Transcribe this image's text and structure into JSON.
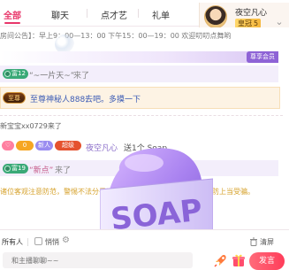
{
  "tabs": [
    {
      "label": "全部",
      "active": true
    },
    {
      "label": "聊天",
      "active": false
    },
    {
      "label": "点才艺",
      "active": false
    },
    {
      "label": "礼单",
      "active": false
    }
  ],
  "host": {
    "name": "夜空凡心",
    "level_label": "皇冠",
    "level_num": "5"
  },
  "chat": {
    "notice": "房间公告】：早上9：00—13：00 下午15：00—19：00 欢迎叨叨点舞哟",
    "vip_tag": "尊享会员",
    "enter1": {
      "level": "富12",
      "nick": "“~一片天~”",
      "msg": "来了"
    },
    "royal": {
      "badge": "至尊",
      "name": "至尊神秘人888：",
      "msg": "去吧。多摸一下"
    },
    "plain": "新宝宝xx0729来了",
    "gift": {
      "badge1": "♡",
      "badge2": "0",
      "badge3": "新人",
      "badge4": "超级",
      "name": "夜空凡心",
      "msg": "送1个 Soap"
    },
    "enter2": {
      "level": "富19",
      "nick": "“新点”",
      "msg": "来了"
    },
    "warning": "诸位客观注意防范，警惕不法分子以低价售卖等诱导性消息欺骗，谨防上当受骗。"
  },
  "sticker": {
    "text": "SOAP"
  },
  "options": {
    "target": "所有人",
    "private": "悄悄",
    "clear": "清屏"
  },
  "input": {
    "placeholder": "和主播聊聊~~"
  },
  "send_label": "发言",
  "colors": {
    "accent": "#e8366a",
    "vip": "#8e63d6",
    "send": "#ff3d5a",
    "warning": "#d6a22c"
  }
}
